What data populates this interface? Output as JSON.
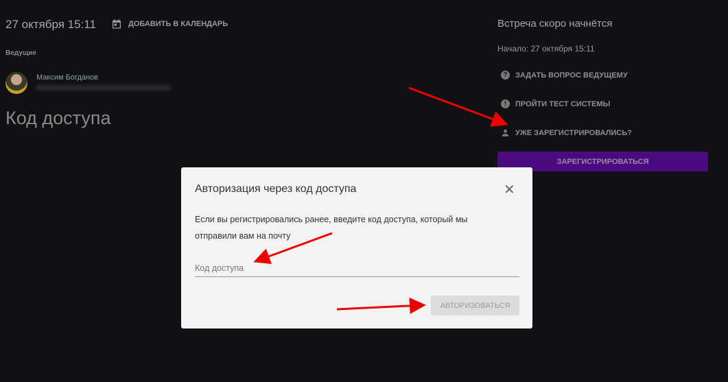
{
  "event": {
    "date": "27 октября 15:11",
    "add_calendar": "ДОБАВИТЬ В КАЛЕНДАРЬ",
    "hosts_label": "Ведущие",
    "host_name": "Максим Богданов",
    "page_title": "Код доступа"
  },
  "sidebar": {
    "title": "Встреча скоро начнётся",
    "start": "Начало: 27 октября 15:11",
    "links": [
      {
        "label": "ЗАДАТЬ ВОПРОС ВЕДУЩЕМУ",
        "icon": "?"
      },
      {
        "label": "ПРОЙТИ ТЕСТ СИСТЕМЫ",
        "icon": "!"
      },
      {
        "label": "УЖЕ ЗАРЕГИСТРИРОВАЛИСЬ?"
      }
    ],
    "register": "ЗАРЕГИСТРИРОВАТЬСЯ"
  },
  "modal": {
    "title": "Авторизация через код доступа",
    "close": "✕",
    "description": "Если вы регистрировались ранее, введите код доступа, который мы отправили вам на почту",
    "placeholder": "Код доступа",
    "submit": "АВТОРИЗОВАТЬСЯ"
  }
}
